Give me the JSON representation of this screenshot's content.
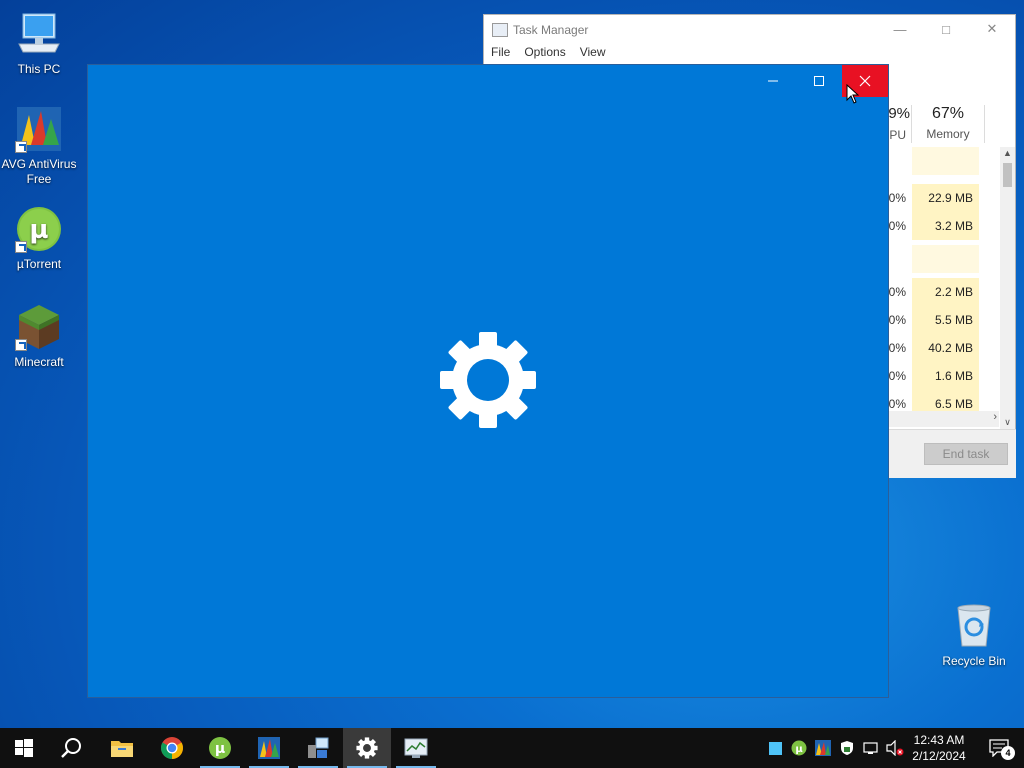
{
  "desktop": {
    "icons": [
      {
        "label": "This PC"
      },
      {
        "label": "AVG AntiVirus Free"
      },
      {
        "label": "µTorrent"
      },
      {
        "label": "Minecraft"
      }
    ],
    "recycle_bin_label": "Recycle Bin"
  },
  "task_manager": {
    "title": "Task Manager",
    "menu": [
      "File",
      "Options",
      "View"
    ],
    "cpu_header_pct": "9%",
    "cpu_header_label": "PU",
    "memory_header_pct": "67%",
    "memory_header_label": "Memory",
    "rows": [
      {
        "cpu": "",
        "memory": ""
      },
      {
        "cpu": "0%",
        "memory": "22.9 MB"
      },
      {
        "cpu": "0%",
        "memory": "3.2 MB"
      },
      {
        "cpu": "",
        "memory": ""
      },
      {
        "cpu": "0%",
        "memory": "2.2 MB"
      },
      {
        "cpu": "0%",
        "memory": "5.5 MB"
      },
      {
        "cpu": "0%",
        "memory": "40.2 MB"
      },
      {
        "cpu": "0%",
        "memory": "1.6 MB"
      },
      {
        "cpu": "0%",
        "memory": "6.5 MB"
      }
    ],
    "end_task_label": "End task"
  },
  "settings_window": {
    "accent_color": "#0078d7",
    "close_hover_color": "#e81123",
    "splash_icon": "gear-icon"
  },
  "taskbar": {
    "pinned": [
      "start-icon",
      "search-icon",
      "file-explorer-icon",
      "chrome-icon",
      "utorrent-icon",
      "avg-icon",
      "control-panel-icon",
      "settings-icon",
      "task-manager-icon"
    ],
    "clock_time": "12:43 AM",
    "clock_date": "2/12/2024",
    "notification_count": "4"
  }
}
